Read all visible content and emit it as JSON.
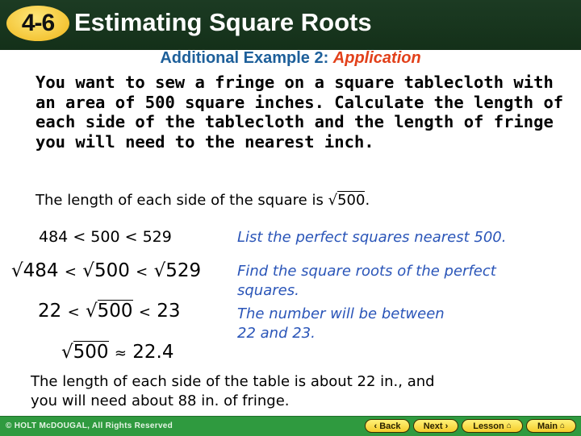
{
  "header": {
    "lesson_number": "4-6",
    "title": "Estimating Square Roots"
  },
  "subtitle": {
    "prefix": "Additional Example 2: ",
    "emphasis": "Application"
  },
  "problem_text": "You want to sew a fringe on a square tablecloth with an area of 500 square inches. Calculate the length of each side of the tablecloth and the length of fringe you will need to the nearest inch.",
  "side_statement": {
    "text": "The length of each side of the square is",
    "radicand": "500",
    "end": "."
  },
  "steps": [
    {
      "math": {
        "a": "484",
        "op1": "<",
        "b": "500",
        "op2": "<",
        "c": "529"
      },
      "note": [
        "List the perfect squares nearest 500."
      ]
    },
    {
      "math": {
        "a": "484",
        "op1": "<",
        "b": "500",
        "op2": "<",
        "c": "529"
      },
      "note": [
        "Find the square roots of the perfect",
        "squares."
      ]
    },
    {
      "math": {
        "a": "22",
        "op1": "<",
        "b": "500",
        "op2": "<",
        "c": "23"
      },
      "note": [
        "The number will be between",
        "22 and 23."
      ]
    },
    {
      "math": {
        "radicand": "500",
        "op": "≈",
        "value": "22.4"
      }
    }
  ],
  "conclusion": [
    "The length of each side of the table is about 22 in., and",
    "you will need about 88 in. of fringe."
  ],
  "footer": {
    "copyright": "© HOLT McDOUGAL, All Rights Reserved",
    "buttons": {
      "back": "Back",
      "back_icon": "‹",
      "next": "Next",
      "next_icon": "›",
      "lesson": "Lesson",
      "main": "Main",
      "home_icon": "⌂"
    }
  },
  "colors": {
    "header_bg": "#1c3b23",
    "badge": "#f4c536",
    "subtitle_blue": "#1d5f9a",
    "application_red": "#e2401a",
    "note_blue": "#2a55b8",
    "footer_green": "#2f9a3f"
  }
}
